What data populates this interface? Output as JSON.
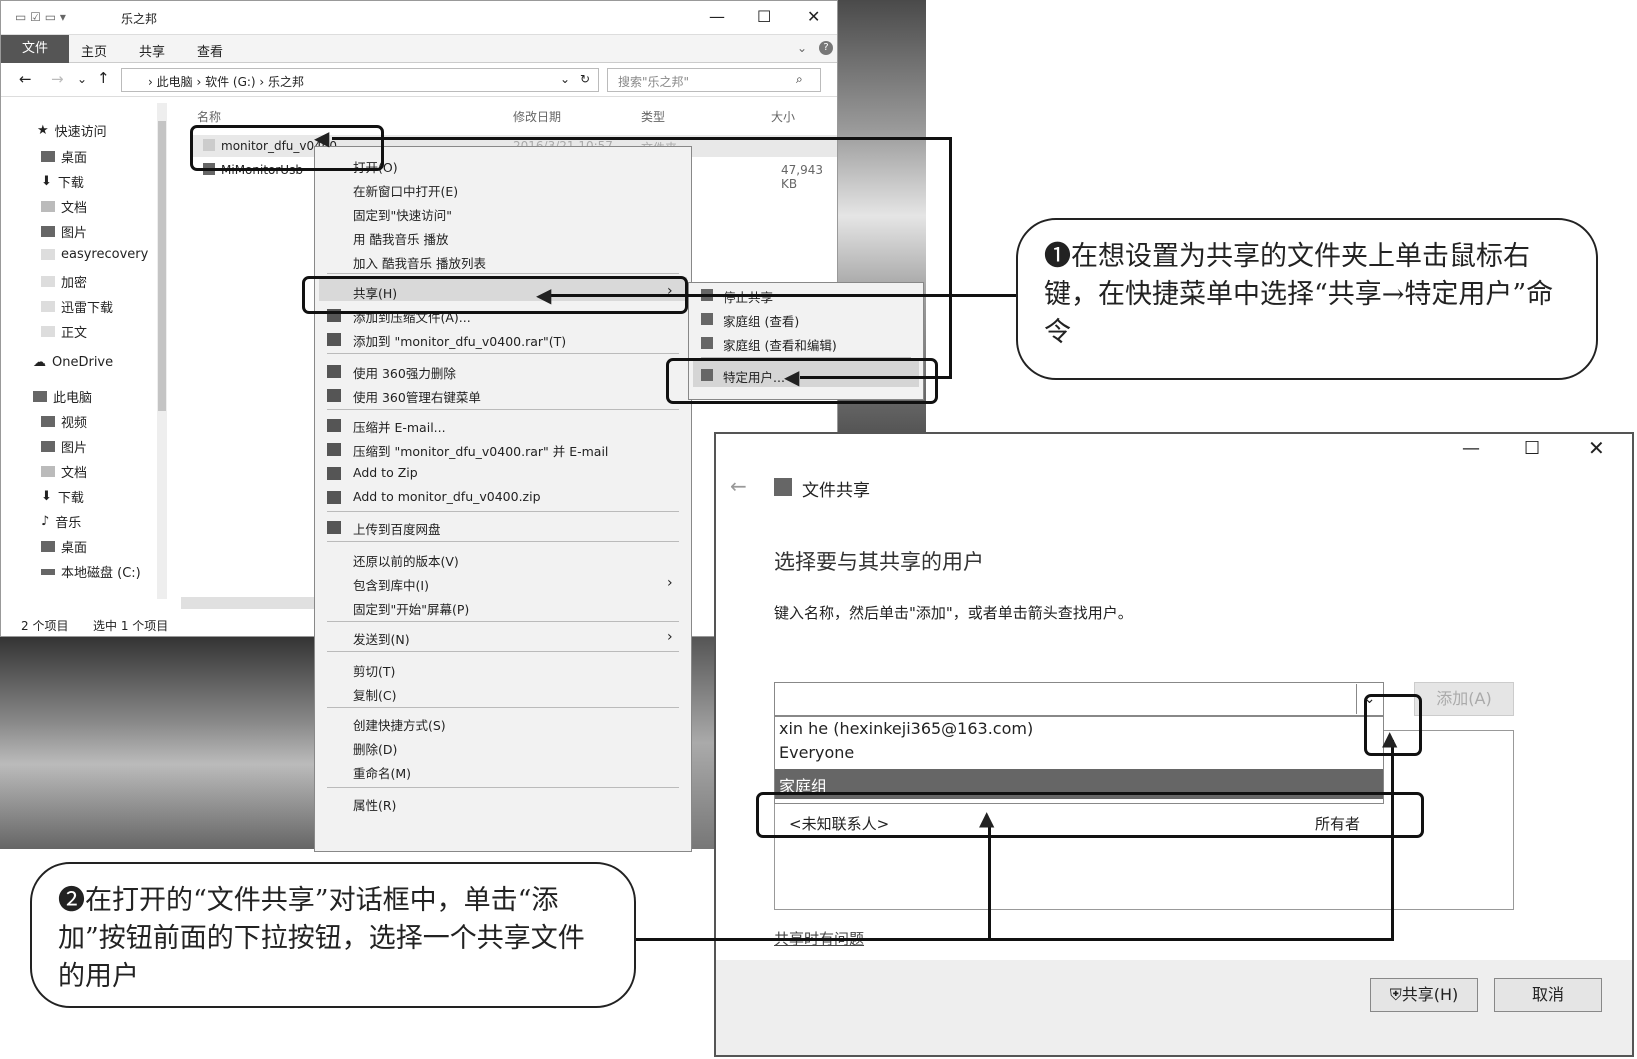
{
  "explorer": {
    "title": "乐之邦",
    "window_controls": [
      "—",
      "☐",
      "✕"
    ],
    "ribbon_tabs": [
      "文件",
      "主页",
      "共享",
      "查看"
    ],
    "breadcrumb": [
      "此电脑",
      "软件 (G:)",
      "乐之邦"
    ],
    "search_placeholder": "搜索\"乐之邦\"",
    "columns": [
      "名称",
      "修改日期",
      "类型",
      "大小"
    ],
    "files": [
      {
        "name": "monitor_dfu_v0400",
        "date": "2016/3/21 10:57",
        "type": "文件夹",
        "size": ""
      },
      {
        "name": "MiMonitorUsb",
        "date": "",
        "type": "",
        "size": "47,943 KB"
      }
    ],
    "nav": [
      "快速访问",
      "桌面",
      "下载",
      "文档",
      "图片",
      "easyrecovery",
      "加密",
      "迅雷下载",
      "正文",
      "OneDrive",
      "此电脑",
      "视频",
      "图片",
      "文档",
      "下载",
      "音乐",
      "桌面",
      "本地磁盘 (C:)"
    ],
    "status_count": "2 个项目",
    "status_selected": "选中 1 个项目"
  },
  "context_menu": [
    "打开(O)",
    "在新窗口中打开(E)",
    "固定到\"快速访问\"",
    "用 酷我音乐 播放",
    "加入 酷我音乐 播放列表",
    "共享(H)",
    "添加到压缩文件(A)...",
    "添加到 \"monitor_dfu_v0400.rar\"(T)",
    "使用 360强力删除",
    "使用 360管理右键菜单",
    "压缩并 E-mail...",
    "压缩到 \"monitor_dfu_v0400.rar\" 并 E-mail",
    "Add to Zip",
    "Add to monitor_dfu_v0400.zip",
    "上传到百度网盘",
    "还原以前的版本(V)",
    "包含到库中(I)",
    "固定到\"开始\"屏幕(P)",
    "发送到(N)",
    "剪切(T)",
    "复制(C)",
    "创建快捷方式(S)",
    "删除(D)",
    "重命名(M)",
    "属性(R)"
  ],
  "submenu": [
    "停止共享",
    "家庭组 (查看)",
    "家庭组 (查看和编辑)",
    "特定用户..."
  ],
  "dialog": {
    "title": "文件共享",
    "heading": "选择要与其共享的用户",
    "instruction": "键入名称，然后单击\"添加\"，或者单击箭头查找用户。",
    "add_button": "添加(A)",
    "options": [
      "xin he (hexinkeji365@163.com)",
      "Everyone",
      "家庭组"
    ],
    "list_row_name": "<未知联系人>",
    "list_row_level": "所有者",
    "help_link": "共享时有问题",
    "share_button": "共享(H)",
    "cancel_button": "取消"
  },
  "callout1": "❶在想设置为共享的文件夹上单击鼠标右键，在快捷菜单中选择“共享→特定用户”命令",
  "callout2": "❷在打开的“文件共享”对话框中，单击“添加”按钮前面的下拉按钮，选择一个共享文件的用户"
}
